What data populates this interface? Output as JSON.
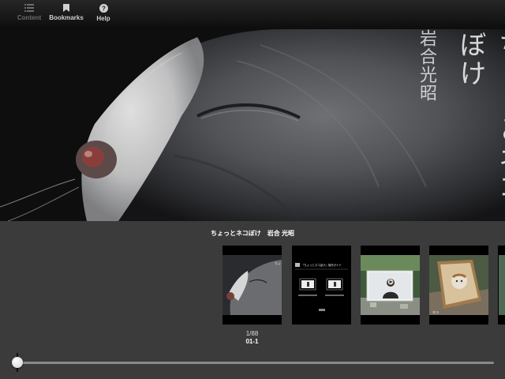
{
  "toolbar": {
    "content_label": "Content",
    "bookmarks_label": "Bookmarks",
    "help_label": "Help"
  },
  "hero": {
    "title_vertical": "ちょっとネコぼけ",
    "author_vertical": "岩合光昭"
  },
  "viewer": {
    "book_title": "ちょっとネコぼけ　岩合 光昭",
    "page_counter": "1/88",
    "page_label": "01-1",
    "current_page": 1,
    "total_pages": 88
  },
  "thumbnails": {
    "items": [
      {
        "name": "cover"
      },
      {
        "name": "guide"
      },
      {
        "name": "video"
      },
      {
        "name": "cat-box"
      },
      {
        "name": "partial"
      }
    ],
    "guide_heading": "『ちょっとネコぼけ』操作ガイド"
  },
  "colors": {
    "toolbar_bg": "#1a1a1a",
    "panel_bg": "#3b3b3b",
    "text_primary": "#ffffff"
  }
}
